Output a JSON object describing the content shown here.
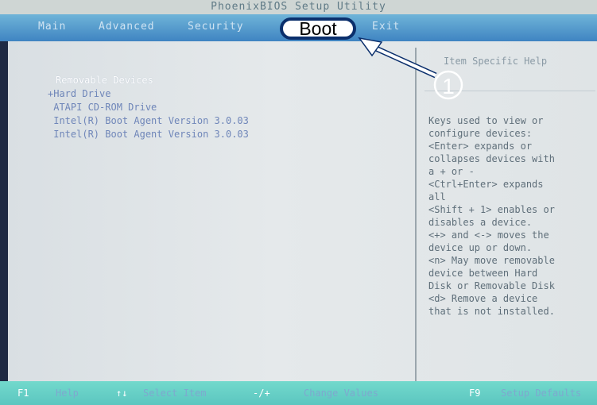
{
  "window": {
    "title": "PhoenixBIOS Setup Utility"
  },
  "menu": {
    "items": [
      "Main",
      "Advanced",
      "Security",
      "Boot",
      "Exit"
    ],
    "selected": "Boot"
  },
  "callout": {
    "number": "1"
  },
  "boot_devices": {
    "title": "Removable Devices",
    "items": [
      "+Hard Drive",
      " ATAPI CD-ROM Drive",
      " Intel(R) Boot Agent Version 3.0.03",
      " Intel(R) Boot Agent Version 3.0.03"
    ]
  },
  "help": {
    "title": "Item Specific Help",
    "lines": [
      "Keys used to view or",
      "configure devices:",
      "<Enter> expands or",
      "collapses devices with",
      "a + or -",
      "<Ctrl+Enter> expands",
      "all",
      "<Shift + 1> enables or",
      "disables a device.",
      "<+> and <-> moves the",
      "device up or down.",
      "<n> May move removable",
      "device between Hard",
      "Disk or Removable Disk",
      "<d> Remove a device",
      "that is not installed."
    ]
  },
  "statusbar": {
    "f1_key": "F1",
    "f1_label": "Help",
    "updown_key": "↑↓",
    "updown_label": "Select Item",
    "minus_plus_key": "-/+",
    "minus_plus_label": "Change Values",
    "f9_key": "F9",
    "f9_label": "Setup Defaults"
  },
  "colors": {
    "menubar": "#4f97cc",
    "statusbar": "#66cfc6",
    "callout_border": "#0b2f6c"
  }
}
